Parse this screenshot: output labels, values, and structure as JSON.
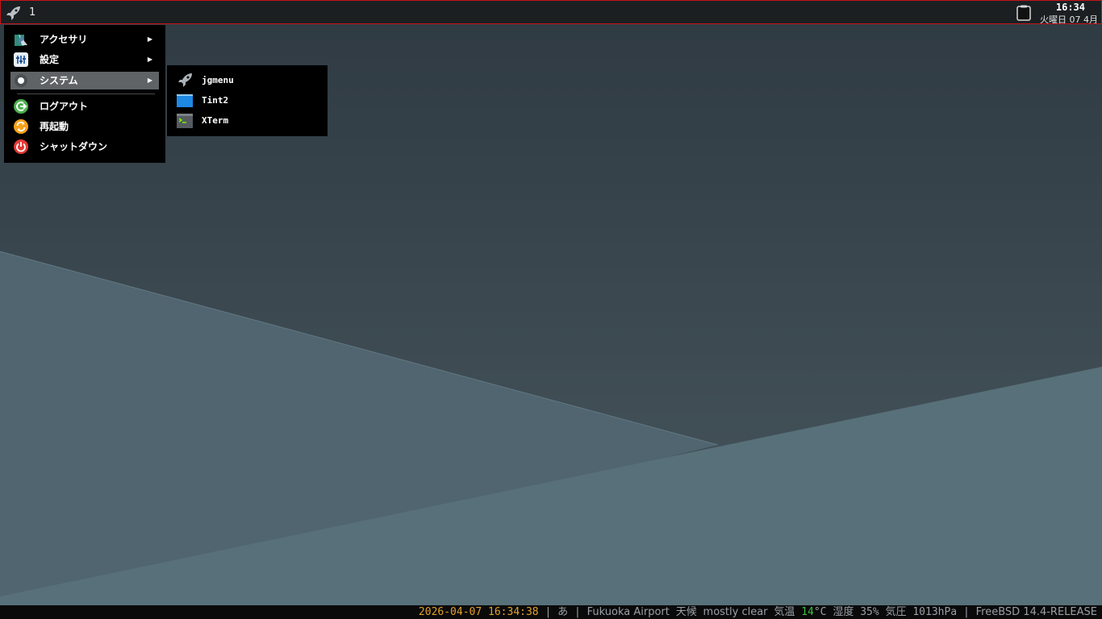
{
  "panel": {
    "launcher_icon": "rocket-icon",
    "desktop_number": "1",
    "clipboard_icon": "clipboard-icon",
    "clock_time": "16:34",
    "clock_date": "火曜日 07 4月"
  },
  "menu": {
    "items": [
      {
        "label": "アクセサリ",
        "icon": "accessories-icon",
        "has_submenu": true
      },
      {
        "label": "設定",
        "icon": "settings-icon",
        "has_submenu": true
      },
      {
        "label": "システム",
        "icon": "system-icon",
        "has_submenu": true,
        "active": true
      },
      {
        "label": "ログアウト",
        "icon": "logout-icon",
        "has_submenu": false
      },
      {
        "label": "再起動",
        "icon": "restart-icon",
        "has_submenu": false
      },
      {
        "label": "シャットダウン",
        "icon": "shutdown-icon",
        "has_submenu": false
      }
    ],
    "arrow": "▶"
  },
  "submenu": {
    "items": [
      {
        "label": "jgmenu",
        "icon": "rocket-icon"
      },
      {
        "label": "Tint2",
        "icon": "tint2-icon"
      },
      {
        "label": "XTerm",
        "icon": "terminal-icon"
      }
    ]
  },
  "status": {
    "datetime": "2026-04-07 16:34:38",
    "sep": "|",
    "ime": "あ",
    "location": "Fukuoka Airport",
    "weather_label": "天候",
    "weather": "mostly clear",
    "temp_label": "気温",
    "temp_value": "14",
    "temp_unit": "°C",
    "humidity_label": "湿度",
    "humidity": "35%",
    "pressure_label": "気圧",
    "pressure": "1013hPa",
    "os": "FreeBSD 14.4-RELEASE"
  },
  "colors": {
    "panel_border": "#c8141a",
    "datetime": "#e3a02a",
    "temperature": "#3fbf3f",
    "menu_highlight": "#5f6366"
  }
}
